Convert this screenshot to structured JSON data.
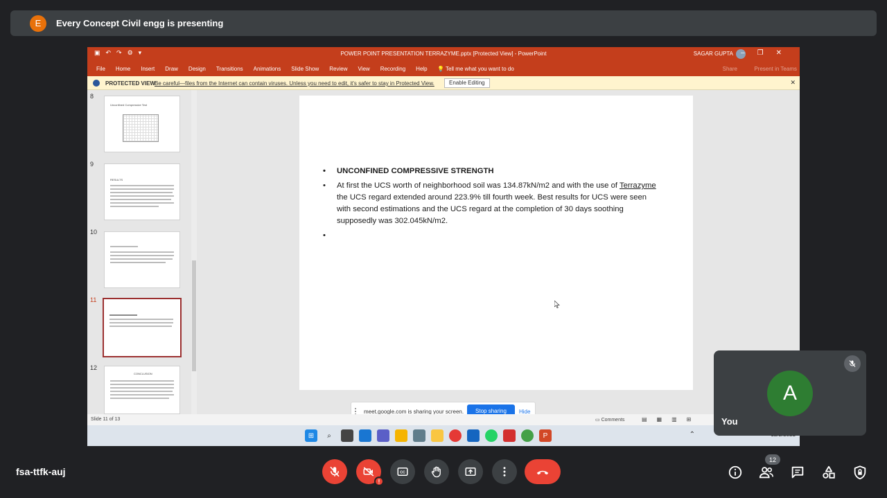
{
  "banner": {
    "avatar_letter": "E",
    "text": "Every Concept Civil engg is presenting"
  },
  "ppt": {
    "doc_title": "POWER POINT PRESENTATION TERRAZYME.pptx [Protected View]  -  PowerPoint",
    "user": "SAGAR GUPTA",
    "tabs": [
      "File",
      "Home",
      "Insert",
      "Draw",
      "Design",
      "Transitions",
      "Animations",
      "Slide Show",
      "Review",
      "View",
      "Recording",
      "Help"
    ],
    "tell_me": "Tell me what you want to do",
    "share": "Share",
    "present_teams": "Present in Teams",
    "protected_label": "PROTECTED VIEW",
    "protected_msg": "Be careful—files from the Internet can contain viruses. Unless you need to edit, it's safer to stay in Protected View.",
    "enable_editing": "Enable Editing",
    "thumb_numbers": [
      "8",
      "9",
      "10",
      "11",
      "12"
    ],
    "thumb_titles": {
      "t8": "Unconfined Compressive Test",
      "t9": "RESULTS",
      "t12": "CONCLUSION"
    },
    "slide": {
      "heading": "UNCONFINED COMPRESSIVE STRENGTH",
      "p1": "At first the UCS worth of neighborhood soil was 134.87kN/m2 and with the use of",
      "p2_underlined": "Terrazyme",
      "p2_rest": " the UCS regard extended around 223.9% till fourth week. Best results for UCS were seen with second estimations and the UCS regard at the completion of 30 days soothing supposedly was 302.045kN/m2."
    },
    "share_bar": {
      "msg": "meet.google.com is sharing your screen.",
      "stop": "Stop sharing",
      "hide": "Hide"
    },
    "status": {
      "slide": "Slide 11 of 13",
      "comments": "Comments"
    },
    "tray": {
      "date": "12/2/2021"
    }
  },
  "self": {
    "letter": "A",
    "label": "You"
  },
  "meeting_code": "fsa-ttfk-auj",
  "participants_count": "12",
  "colors": {
    "end_call": "#ea4335",
    "self_avatar": "#2e7d32",
    "ppt_ribbon": "#c43e1c",
    "stop_sharing": "#1a73e8"
  }
}
